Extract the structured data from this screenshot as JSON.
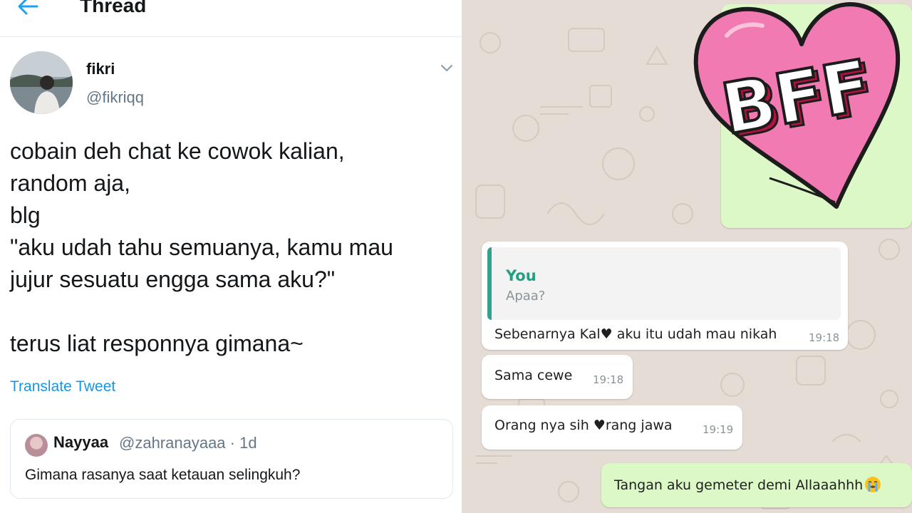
{
  "twitter": {
    "header": {
      "title": "Thread"
    },
    "tweet": {
      "author_name": "fikri",
      "author_handle": "@fikriqq",
      "lines": [
        "cobain deh chat ke cowok kalian,",
        "random aja,",
        "blg",
        "\"aku udah tahu semuanya, kamu mau",
        "jujur sesuatu engga sama aku?\"",
        "terus liat responnya gimana~"
      ],
      "translate_label": "Translate Tweet"
    },
    "quote": {
      "name": "Nayyaa",
      "handle_time": "@zahranayaaa · 1d",
      "text": "Gimana rasanya saat ketauan selingkuh?"
    }
  },
  "chat": {
    "sticker_text": "BFF",
    "messages": [
      {
        "reply_to": {
          "name": "You",
          "text": "Apaa?"
        },
        "text": "Sebenarnya Kal♥ aku itu udah mau nikah",
        "time": "19:18"
      },
      {
        "text": "Sama cewe",
        "time": "19:18"
      },
      {
        "text": "Orang nya sih ♥rang jawa",
        "time": "19:19"
      },
      {
        "text": "Tangan aku gemeter demi Allaaahhh",
        "emoji": "loudly-crying-face"
      }
    ],
    "colors": {
      "incoming_bubble": "#ffffff",
      "outgoing_bubble": "#dcf8c6",
      "reply_accent": "#35a090",
      "wallpaper": "#e5ddd5",
      "sticker_heart": "#f07ab1"
    }
  },
  "colors": {
    "twitter_link": "#1b95e0",
    "twitter_secondary": "#657786"
  }
}
